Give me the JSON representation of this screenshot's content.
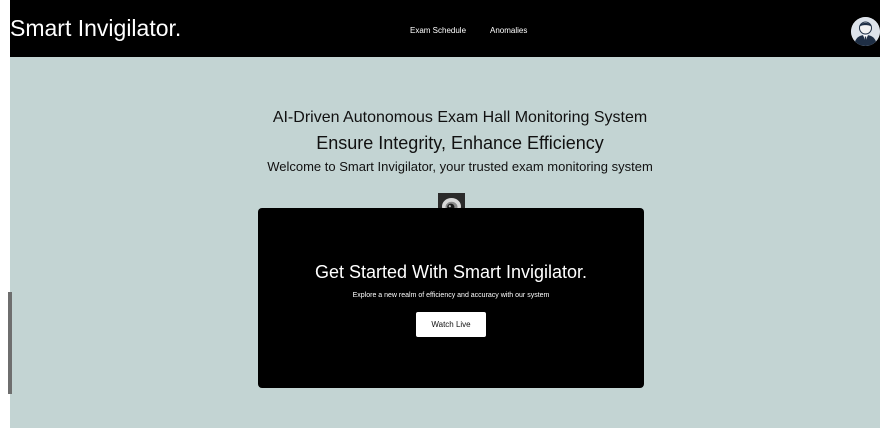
{
  "navbar": {
    "brand": "Smart Invigilator.",
    "links": [
      "Exam Schedule",
      "Anomalies"
    ],
    "avatar_icon": "user-avatar-icon"
  },
  "hero": {
    "line1": "AI-Driven Autonomous Exam Hall Monitoring System",
    "line2": "Ensure Integrity, Enhance Efficiency",
    "line3": "Welcome to Smart Invigilator, your trusted exam monitoring system",
    "camera_icon": "security-camera-icon"
  },
  "card": {
    "title": "Get Started With Smart Invigilator.",
    "subtitle": "Explore a new realm of efficiency and accuracy with our system",
    "button_label": "Watch Live"
  },
  "colors": {
    "page_background": "#c3d4d3",
    "navbar_background": "#000000",
    "card_background": "#000000",
    "button_background": "#ffffff"
  }
}
